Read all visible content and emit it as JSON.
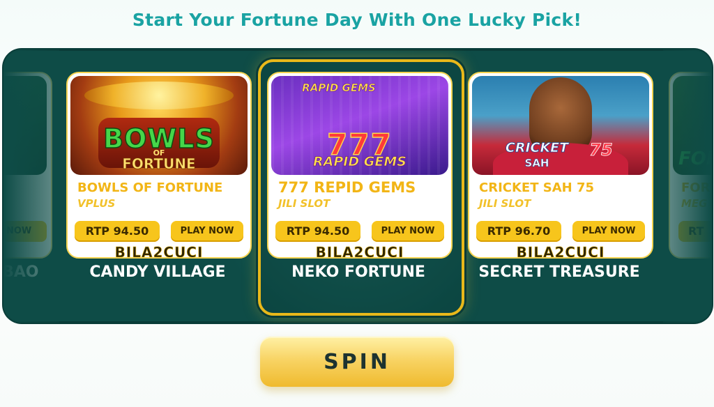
{
  "headline": "Start Your Fortune Day With One Lucky Pick!",
  "colors": {
    "accent": "#1aa3a3",
    "stage": "#0e4c47",
    "gold": "#f7c51c",
    "selector_border": "#e9b81a"
  },
  "left_partial": {
    "button_text": "NOW",
    "label": "BAO"
  },
  "right_partial": {
    "art_text": "FOR",
    "name_text": "FOR",
    "prov_text": "MEG",
    "rtp_text": "RT"
  },
  "cards": [
    {
      "art_line1": "BOWLS",
      "art_line2": "OF",
      "art_line3": "FORTUNE",
      "name": "BOWLS OF FORTUNE",
      "provider": "VPLUS",
      "rtp": "RTP 94.50",
      "play": "PLAY NOW",
      "brand": "BILA2CUCI",
      "label": "CANDY VILLAGE",
      "icon": "game-thumbnail"
    },
    {
      "art_line1": "RAPID GEMS",
      "art_line2": "777",
      "art_line3": "RAPID GEMS",
      "name": "777 REPID GEMS",
      "provider": "JILI SLOT",
      "rtp": "RTP 94.50",
      "play": "PLAY NOW",
      "brand": "BILA2CUCI",
      "label": "NEKO FORTUNE",
      "icon": "game-thumbnail"
    },
    {
      "art_line1": "CRICKET",
      "art_line2": "SAH",
      "art_line3": "75",
      "name": "CRICKET SAH 75",
      "provider": "JILI SLOT",
      "rtp": "RTP 96.70",
      "play": "PLAY NOW",
      "brand": "BILA2CUCI",
      "label": "SECRET TREASURE",
      "icon": "game-thumbnail"
    }
  ],
  "spin_label": "SPIN"
}
